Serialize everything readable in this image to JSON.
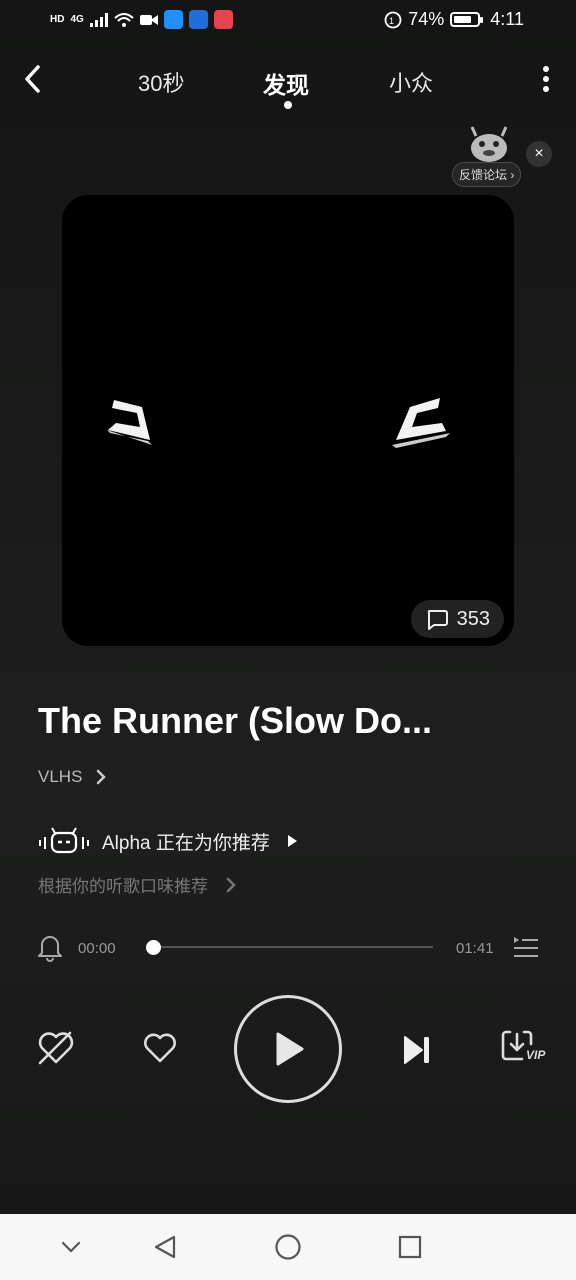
{
  "status_bar": {
    "hd": "HD",
    "network": "4G",
    "battery_percent": "74%",
    "battery_level": 0.74,
    "time": "4:11",
    "app_icon_colors": [
      "#1e90ff",
      "#1e6fd9",
      "#e8424f"
    ]
  },
  "top_nav": {
    "tabs": [
      {
        "label": "30秒",
        "active": false
      },
      {
        "label": "发现",
        "active": true
      },
      {
        "label": "小众",
        "active": false
      }
    ]
  },
  "feedback": {
    "label": "反馈论坛 ›",
    "close": "×"
  },
  "cover": {
    "comment_count": "353"
  },
  "song": {
    "title": "The Runner (Slow Do...",
    "artist": "VLHS",
    "alpha_text": "Alpha 正在为你推荐",
    "reco_subtitle": "根据你的听歌口味推荐"
  },
  "player": {
    "current_time": "00:00",
    "total_time": "01:41",
    "progress": 0.0,
    "vip_label": "VIP"
  },
  "colors": {
    "background": "#1b1c1b",
    "accent": "#ffffff",
    "muted_text": "#777777"
  }
}
